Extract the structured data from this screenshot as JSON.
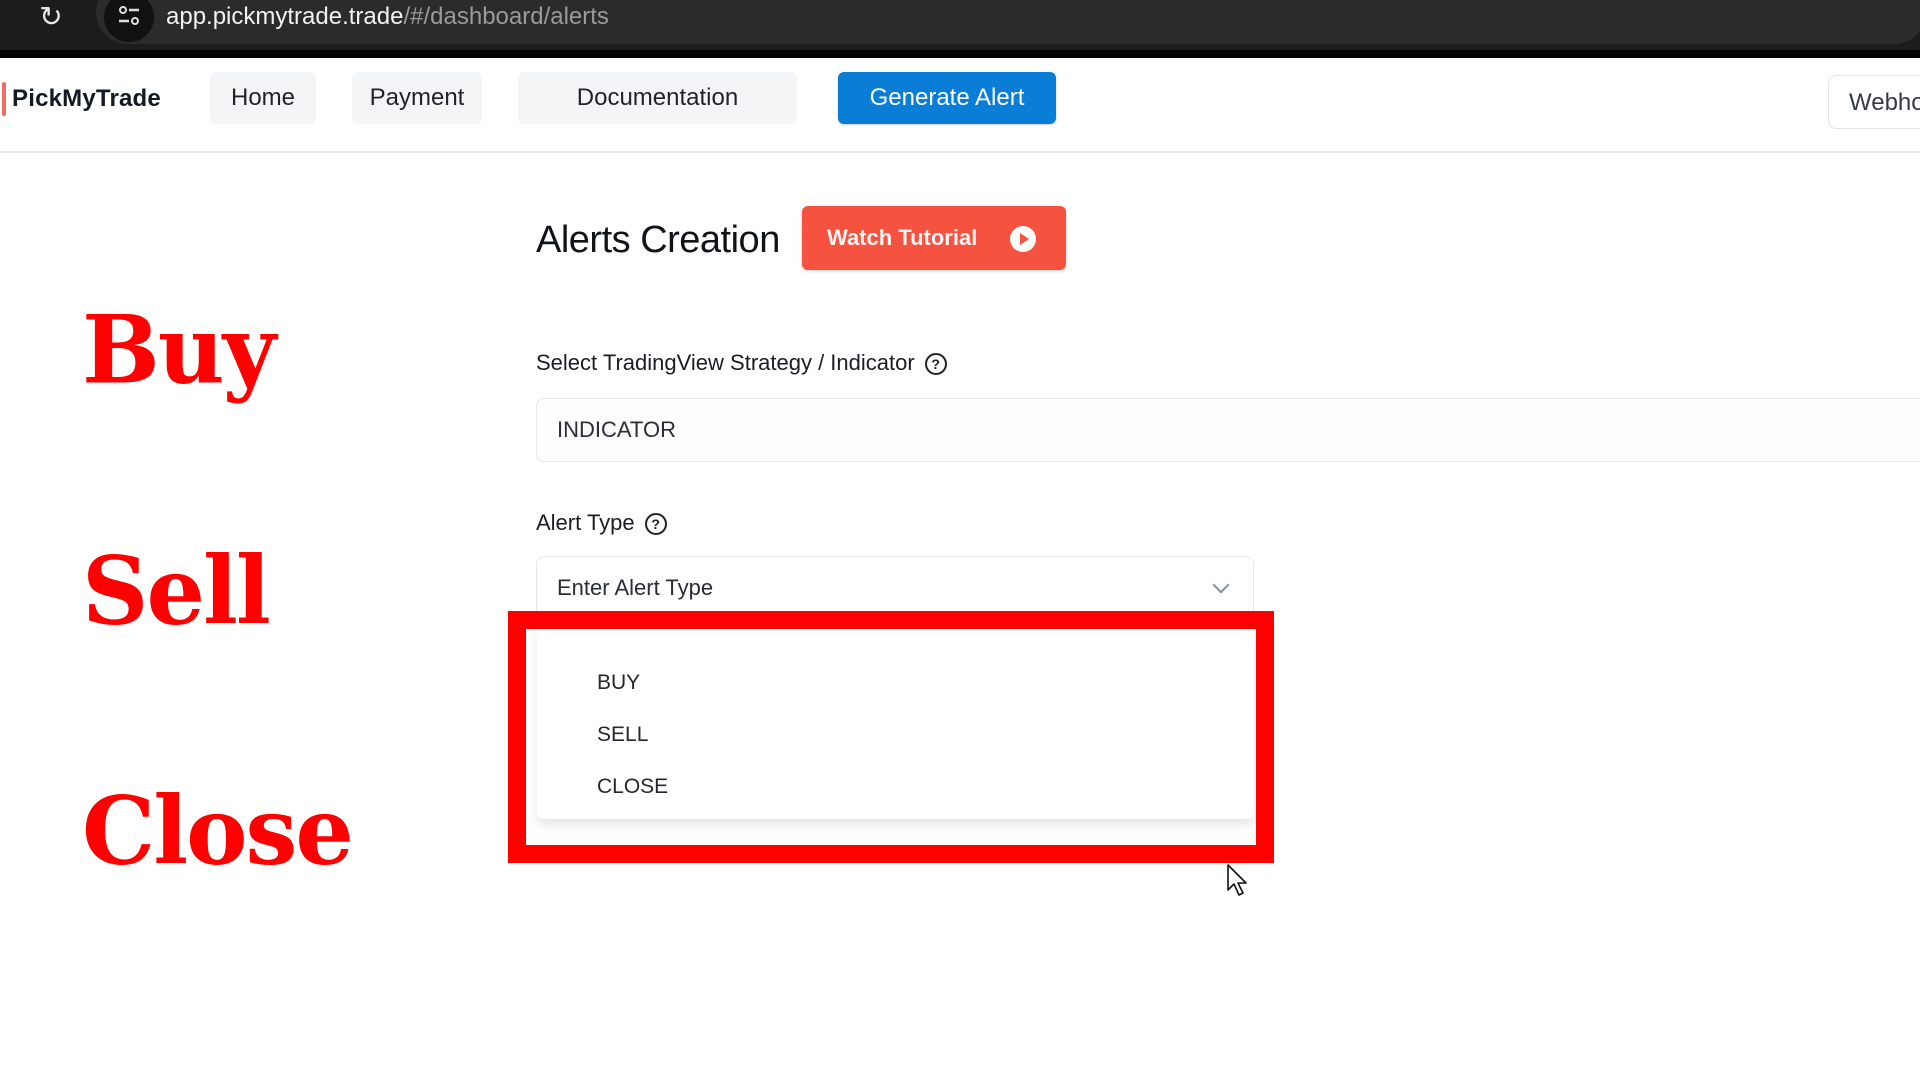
{
  "browser": {
    "url_host": "app.pickmytrade.trade",
    "url_path": "/#/dashboard/alerts"
  },
  "header": {
    "logo": "PickMyTrade",
    "nav": [
      {
        "label": "Home"
      },
      {
        "label": "Payment"
      },
      {
        "label": "Documentation"
      },
      {
        "label": "Generate Alert"
      }
    ],
    "webhook_label": "Webhook"
  },
  "overlay": {
    "labels": [
      "Buy",
      "Sell",
      "Close"
    ],
    "color": "#ff0000"
  },
  "main": {
    "title": "Alerts Creation",
    "tutorial_button": "Watch Tutorial",
    "strategy_field": {
      "label": "Select TradingView Strategy / Indicator",
      "value": "INDICATOR"
    },
    "alert_type_field": {
      "label": "Alert Type",
      "placeholder": "Enter Alert Type",
      "options": [
        "BUY",
        "SELL",
        "CLOSE"
      ]
    }
  },
  "colors": {
    "primary": "#0a7dd6",
    "tutorial": "#f5533f",
    "highlight": "#ff0000"
  }
}
